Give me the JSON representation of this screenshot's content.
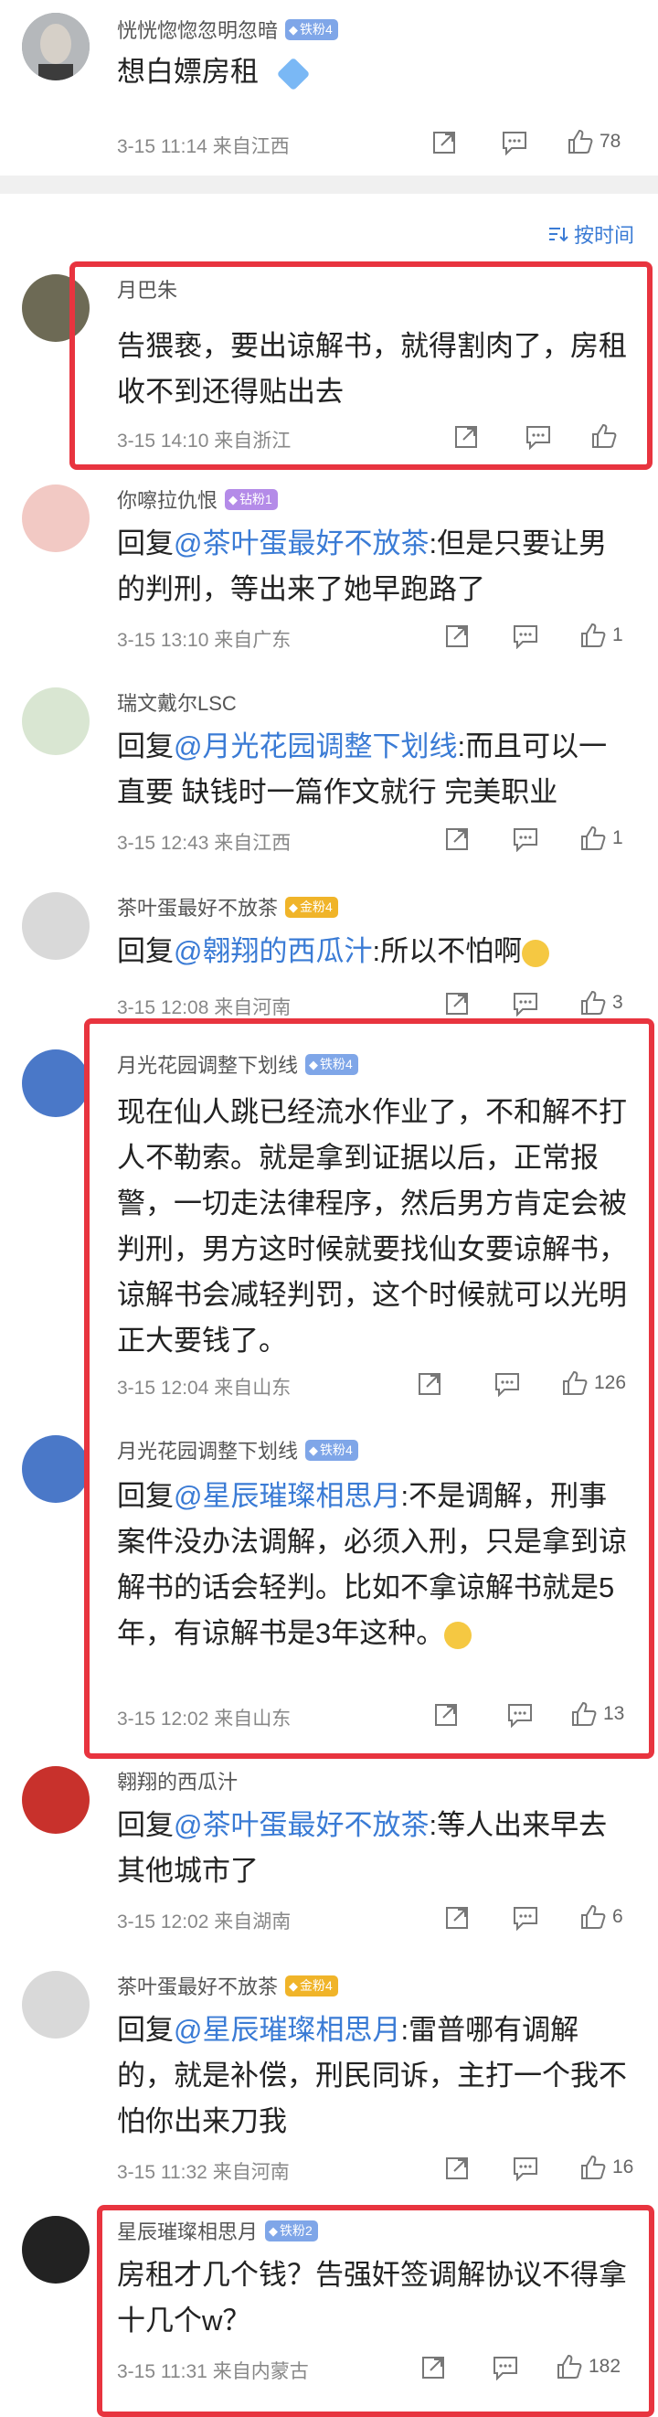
{
  "top_comment": {
    "username": "恍恍惚惚忽明忽暗",
    "badge": "铁粉4",
    "text": "想白嫖房租",
    "meta": "3-15 11:14  来自江西",
    "likes": "78"
  },
  "sort_label": "按时间",
  "comments": [
    {
      "username": "月巴朱",
      "badge": "",
      "text": "告猥亵，要出谅解书，就得割肉了，房租收不到还得贴出去",
      "meta": "3-15 14:10  来自浙江",
      "likes": ""
    },
    {
      "username": "你嚓拉仇恨",
      "badge": "钻粉1",
      "prefix": "回复",
      "mention": "@茶叶蛋最好不放茶",
      "text": ":但是只要让男的判刑，等出来了她早跑路了",
      "meta": "3-15 13:10  来自广东",
      "likes": "1"
    },
    {
      "username": "瑞文戴尔LSC",
      "badge": "",
      "prefix": "回复",
      "mention": "@月光花园调整下划线",
      "text": ":而且可以一直要  缺钱时一篇作文就行 完美职业",
      "meta": "3-15 12:43  来自江西",
      "likes": "1"
    },
    {
      "username": "茶叶蛋最好不放茶",
      "badge": "金粉4",
      "prefix": "回复",
      "mention": "@翱翔的西瓜汁",
      "text": ":所以不怕啊",
      "meta": "3-15 12:08  来自河南",
      "likes": "3"
    },
    {
      "username": "月光花园调整下划线",
      "badge": "铁粉4",
      "text": "现在仙人跳已经流水作业了，不和解不打人不勒索。就是拿到证据以后，正常报警，一切走法律程序，然后男方肯定会被判刑，男方这时候就要找仙女要谅解书，谅解书会减轻判罚，这个时候就可以光明正大要钱了。",
      "meta": "3-15 12:04  来自山东",
      "likes": "126"
    },
    {
      "username": "月光花园调整下划线",
      "badge": "铁粉4",
      "prefix": "回复",
      "mention": "@星辰璀璨相思月",
      "text": ":不是调解，刑事案件没办法调解，必须入刑，只是拿到谅解书的话会轻判。比如不拿谅解书就是5年，有谅解书是3年这种。",
      "meta": "3-15 12:02  来自山东",
      "likes": "13"
    },
    {
      "username": "翱翔的西瓜汁",
      "badge": "",
      "prefix": "回复",
      "mention": "@茶叶蛋最好不放茶",
      "text": ":等人出来早去其他城市了",
      "meta": "3-15 12:02  来自湖南",
      "likes": "6"
    },
    {
      "username": "茶叶蛋最好不放茶",
      "badge": "金粉4",
      "prefix": "回复",
      "mention": "@星辰璀璨相思月",
      "text": ":雷普哪有调解的，就是补偿，刑民同诉，主打一个我不怕你出来刀我",
      "meta": "3-15 11:32  来自河南",
      "likes": "16"
    },
    {
      "username": "星辰璀璨相思月",
      "badge": "铁粉2",
      "text": "房租才几个钱？告强奸签调解协议不得拿十几个w？",
      "meta": "3-15 11:31  来自内蒙古",
      "likes": "182"
    }
  ],
  "colors": {
    "accent": "#3a7bd5",
    "highlight": "#e8343f",
    "iron_badge": "#7fa6e8",
    "gold_badge": "#f0b429",
    "diamond_badge": "#b48be8"
  }
}
